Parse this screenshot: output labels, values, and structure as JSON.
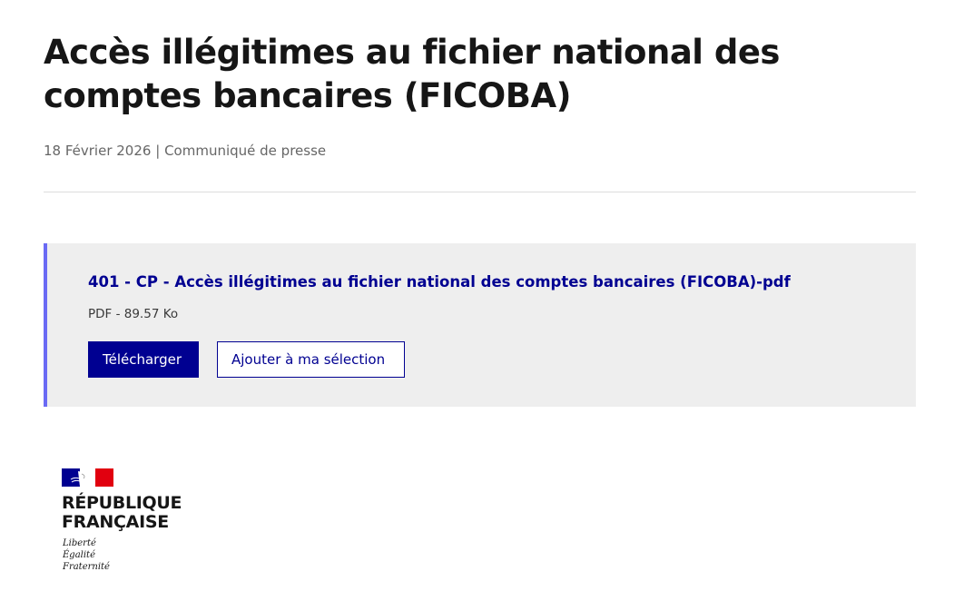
{
  "header": {
    "title": "Accès illégitimes au fichier national des comptes bancaires (FICOBA)",
    "date": "18 Février 2026",
    "separator": "|",
    "category": "Communiqué de presse"
  },
  "download": {
    "file_title": "401 - CP - Accès illégitimes au fichier national des comptes bancaires (FICOBA)-pdf",
    "file_info": "PDF - 89.57 Ko",
    "download_label": "Télécharger",
    "add_selection_label": "Ajouter à ma sélection"
  },
  "footer_logo": {
    "name_line1": "RÉPUBLIQUE",
    "name_line2": "FRANÇAISE",
    "motto_line1": "Liberté",
    "motto_line2": "Égalité",
    "motto_line3": "Fraternité",
    "flag_colors": [
      "#000091",
      "#ffffff",
      "#e1000f"
    ]
  },
  "colors": {
    "accent_blue": "#000091",
    "card_border": "#6a6af4",
    "card_bg": "#eeeeee",
    "text_muted": "#666666"
  }
}
